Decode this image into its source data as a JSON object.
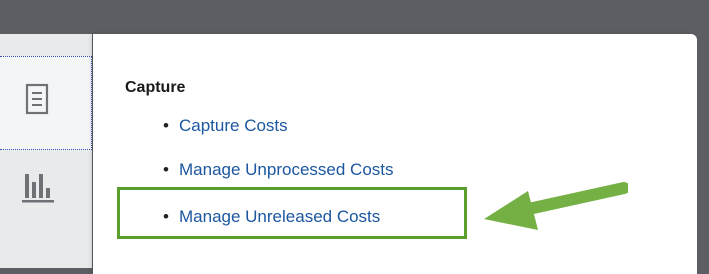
{
  "section": {
    "title": "Capture",
    "links": [
      {
        "label": "Capture Costs"
      },
      {
        "label": "Manage Unprocessed Costs"
      },
      {
        "label": "Manage Unreleased Costs"
      }
    ]
  },
  "icons": {
    "tab_document": "document-list-icon",
    "tab_chart": "bar-chart-icon",
    "annotation": "green-arrow-icon"
  },
  "colors": {
    "header_bg": "#5b5e62",
    "link": "#1c57a0",
    "highlight": "#5a9e2e",
    "panel_bg": "#ffffff"
  }
}
